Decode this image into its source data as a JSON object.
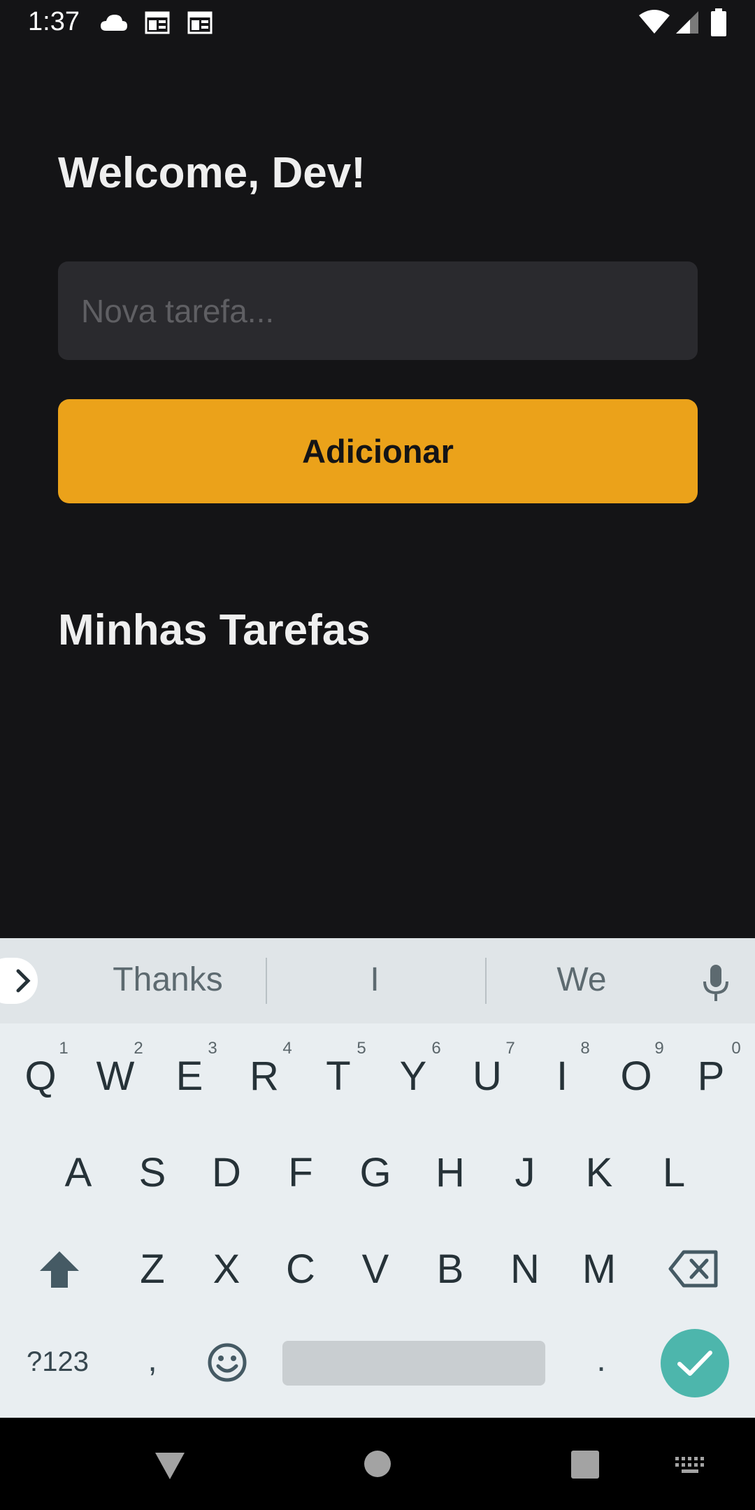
{
  "status_bar": {
    "time": "1:37",
    "icons_left": [
      "cloud-icon",
      "calendar-icon",
      "calendar-icon"
    ],
    "icons_right": [
      "wifi-icon",
      "signal-icon",
      "battery-icon"
    ]
  },
  "app": {
    "greeting": "Welcome, Dev!",
    "task_input": {
      "placeholder": "Nova tarefa...",
      "value": ""
    },
    "add_button_label": "Adicionar",
    "section_title": "Minhas Tarefas"
  },
  "keyboard": {
    "suggestions": [
      "Thanks",
      "I",
      "We"
    ],
    "row1": [
      "Q",
      "W",
      "E",
      "R",
      "T",
      "Y",
      "U",
      "I",
      "O",
      "P"
    ],
    "row1_hints": [
      "1",
      "2",
      "3",
      "4",
      "5",
      "6",
      "7",
      "8",
      "9",
      "0"
    ],
    "row2": [
      "A",
      "S",
      "D",
      "F",
      "G",
      "H",
      "J",
      "K",
      "L"
    ],
    "row3": [
      "Z",
      "X",
      "C",
      "V",
      "B",
      "N",
      "M"
    ],
    "symbols_label": "?123",
    "comma": ",",
    "period": "."
  },
  "colors": {
    "background": "#141416",
    "input_bg": "#2a2a2e",
    "accent": "#eba21a",
    "keyboard_bg": "#e9eef1",
    "enter_key": "#4db6ac"
  }
}
